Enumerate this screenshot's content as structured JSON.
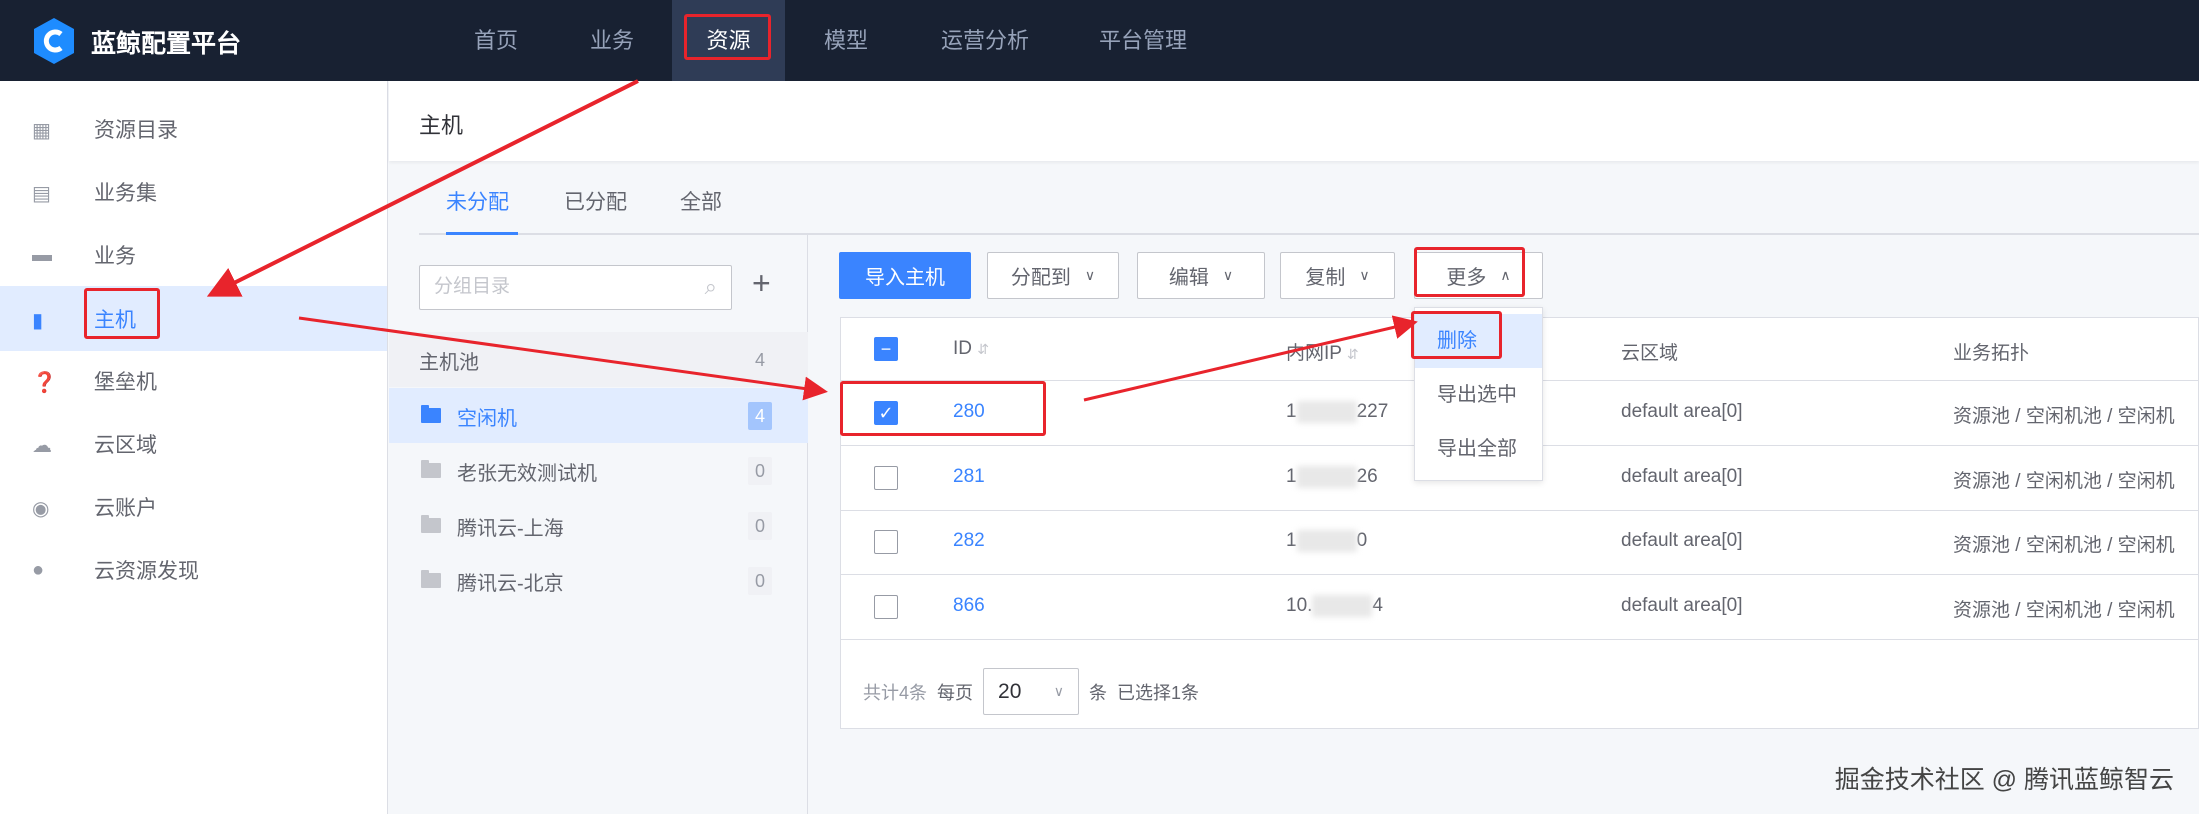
{
  "app": {
    "title": "蓝鲸配置平台"
  },
  "nav": [
    "首页",
    "业务",
    "资源",
    "模型",
    "运营分析",
    "平台管理"
  ],
  "sidebar": [
    "资源目录",
    "业务集",
    "业务",
    "主机",
    "堡垒机",
    "云区域",
    "云账户",
    "云资源发现"
  ],
  "page": {
    "title": "主机",
    "tabs": [
      "未分配",
      "已分配",
      "全部"
    ]
  },
  "groups": {
    "search_placeholder": "分组目录",
    "add": "+",
    "pool": {
      "label": "主机池",
      "count": "4"
    },
    "items": [
      {
        "label": "空闲机",
        "count": "4"
      },
      {
        "label": "老张无效测试机",
        "count": "0"
      },
      {
        "label": "腾讯云-上海",
        "count": "0"
      },
      {
        "label": "腾讯云-北京",
        "count": "0"
      }
    ]
  },
  "toolbar": {
    "import": "导入主机",
    "assign": "分配到",
    "edit": "编辑",
    "copy": "复制",
    "more": "更多"
  },
  "more_menu": [
    "删除",
    "导出选中",
    "导出全部"
  ],
  "table": {
    "headers": [
      "ID",
      "内网IP",
      "云区域",
      "业务拓扑"
    ],
    "rows": [
      {
        "id": "280",
        "ip_pre": "1",
        "ip_suf": "227",
        "area": "default area[0]",
        "topo": "资源池 / 空闲机池 / 空闲机",
        "checked": true
      },
      {
        "id": "281",
        "ip_pre": "1",
        "ip_suf": "26",
        "area": "default area[0]",
        "topo": "资源池 / 空闲机池 / 空闲机",
        "checked": false
      },
      {
        "id": "282",
        "ip_pre": "1",
        "ip_suf": "0",
        "area": "default area[0]",
        "topo": "资源池 / 空闲机池 / 空闲机",
        "checked": false
      },
      {
        "id": "866",
        "ip_pre": "10.",
        "ip_suf": "4",
        "area": "default area[0]",
        "topo": "资源池 / 空闲机池 / 空闲机",
        "checked": false
      }
    ]
  },
  "pager": {
    "total": "共计4条",
    "per_page": "每页",
    "size": "20",
    "unit": "条",
    "selected": "已选择1条"
  },
  "watermark": "掘金技术社区 @ 腾讯蓝鲸智云",
  "colors": {
    "accent": "#3a84ff",
    "topbar": "#182132",
    "annotation": "#e8242c"
  }
}
